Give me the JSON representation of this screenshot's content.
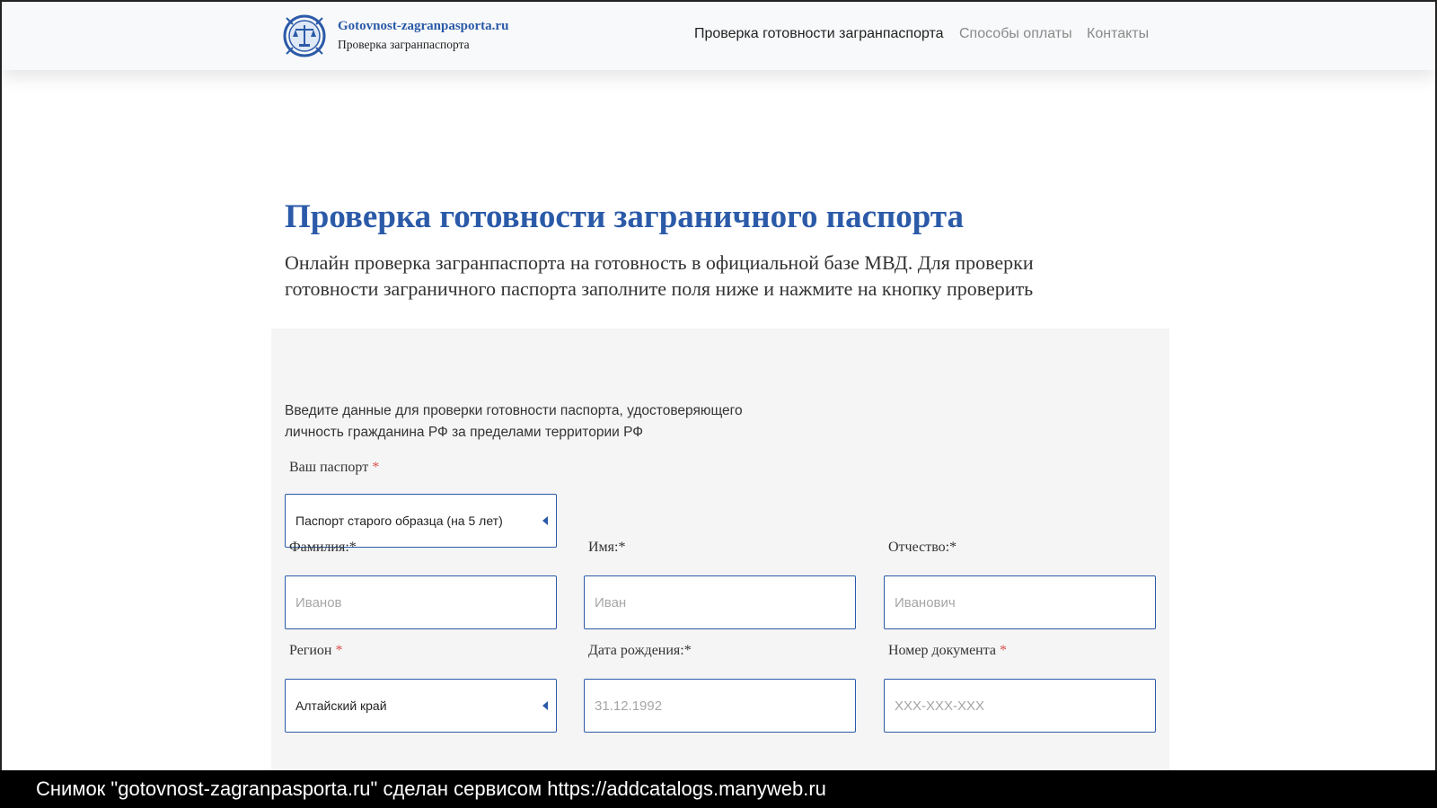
{
  "header": {
    "brand_name": "Gotovnost-zagranpasporta.ru",
    "brand_sub": "Проверка загранпаспорта",
    "nav": [
      {
        "label": "Проверка готовности загранпаспорта",
        "active": true
      },
      {
        "label": "Способы оплаты",
        "active": false
      },
      {
        "label": "Контакты",
        "active": false
      }
    ]
  },
  "hero": {
    "title": "Проверка готовности заграничного паспорта",
    "lead": "Онлайн проверка загранпаспорта на готовность в официальной базе МВД. Для проверки готовности заграничного паспорта заполните поля ниже и нажмите на кнопку проверить"
  },
  "form": {
    "intro_line1": "Введите данные для проверки готовности паспорта, удостоверяющего",
    "intro_line2": "личность гражданина РФ за пределами территории РФ",
    "passport": {
      "label": "Ваш паспорт",
      "required_mark": "*",
      "value": "Паспорт старого образца (на 5 лет)"
    },
    "surname": {
      "label": "Фамилия:*",
      "placeholder": "Иванов"
    },
    "name": {
      "label": "Имя:*",
      "placeholder": "Иван"
    },
    "patronymic": {
      "label": "Отчество:*",
      "placeholder": "Иванович"
    },
    "region": {
      "label": "Регион",
      "required_mark": "*",
      "value": "Алтайский край"
    },
    "birthdate": {
      "label": "Дата рождения:*",
      "placeholder": "31.12.1992"
    },
    "doc_number": {
      "label": "Номер документа",
      "required_mark": "*",
      "placeholder": "XXX-XXX-XXX"
    }
  },
  "footer": {
    "caption": "Снимок \"gotovnost-zagranpasporta.ru\" сделан сервисом https://addcatalogs.manyweb.ru"
  },
  "colors": {
    "accent": "#2b5aa8",
    "required": "#d9534f",
    "panel_bg": "#f5f5f5"
  },
  "icons": {
    "logo": "emblem-scales-logo-icon",
    "select_caret": "caret-left-icon"
  }
}
